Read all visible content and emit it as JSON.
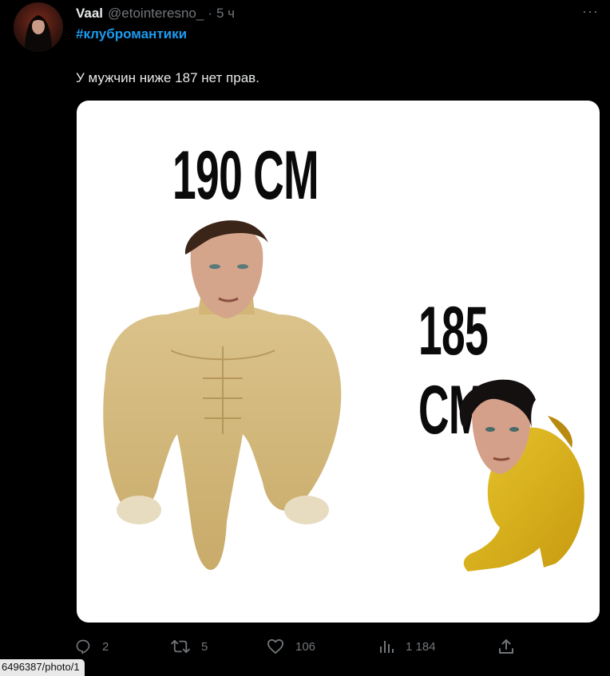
{
  "author": {
    "name": "Vaal",
    "handle": "@etointeresno_",
    "separator": "·",
    "time": "5 ч"
  },
  "more_label": "···",
  "tweet": {
    "hashtag": "#клубромантики",
    "text": "У мужчин ниже 187 нет прав."
  },
  "media": {
    "left_label": "190 CM",
    "right_label": "185 CM"
  },
  "actions": {
    "replies": "2",
    "retweets": "5",
    "likes": "106",
    "views": "1 184"
  },
  "status_bar": {
    "url": "6496387/photo/1"
  },
  "colors": {
    "background": "#000000",
    "accent": "#1d9bf0",
    "muted": "#71767b",
    "text": "#e7e9ea"
  }
}
